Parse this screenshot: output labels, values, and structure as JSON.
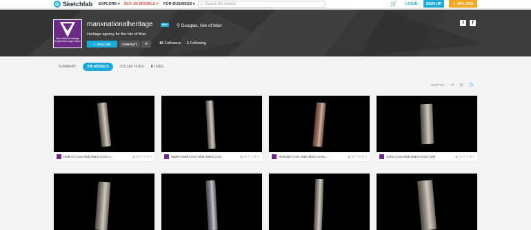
{
  "topbar": {
    "logo_text": "Sketchfab",
    "nav": [
      "EXPLORE",
      "BUY 3D MODELS",
      "FOR BUSINESS"
    ],
    "search_placeholder": "Search 3D models",
    "login": "LOGIN",
    "signup": "SIGN UP",
    "upload": "UPLOAD"
  },
  "profile": {
    "name": "manxnationalheritage",
    "badge": "PRO",
    "location": "Douglas, Isle of Man",
    "bio": "Heritage agency for the Isle of Man",
    "avatar_text": "Manx National Heritage\nEiraght Ashoonagh Vannin",
    "follow": "FOLLOW",
    "contact": "CONTACT",
    "followers_count": "16",
    "followers_label": "Followers",
    "following_count": "1",
    "following_label": "Following"
  },
  "tabs": {
    "summary": "SUMMARY",
    "models": "235 MODELS",
    "collections": "COLLECTIONS",
    "likes_count": "0",
    "likes_label": "LIKES"
  },
  "sort_label": "SORT BY",
  "cards": [
    {
      "title": "Hedin's Cross Slab (Manx Cross 1...",
      "views": "38",
      "comments": "0",
      "likes": "0"
    },
    {
      "title": "Speke Keeill Cross Slab (Manx Cros...",
      "views": "26",
      "comments": "0",
      "likes": "0"
    },
    {
      "title": "Heimdall Cross Slab (Manx Cross ...",
      "views": "32",
      "comments": "0",
      "likes": "0"
    },
    {
      "title": "Jurby Cross Slab (Manx Cross 134)",
      "views": "24",
      "comments": "0",
      "likes": "0"
    }
  ],
  "colors": {
    "accent": "#1caad9",
    "upload": "#f5a623",
    "brand_purple": "#6b2a86"
  }
}
